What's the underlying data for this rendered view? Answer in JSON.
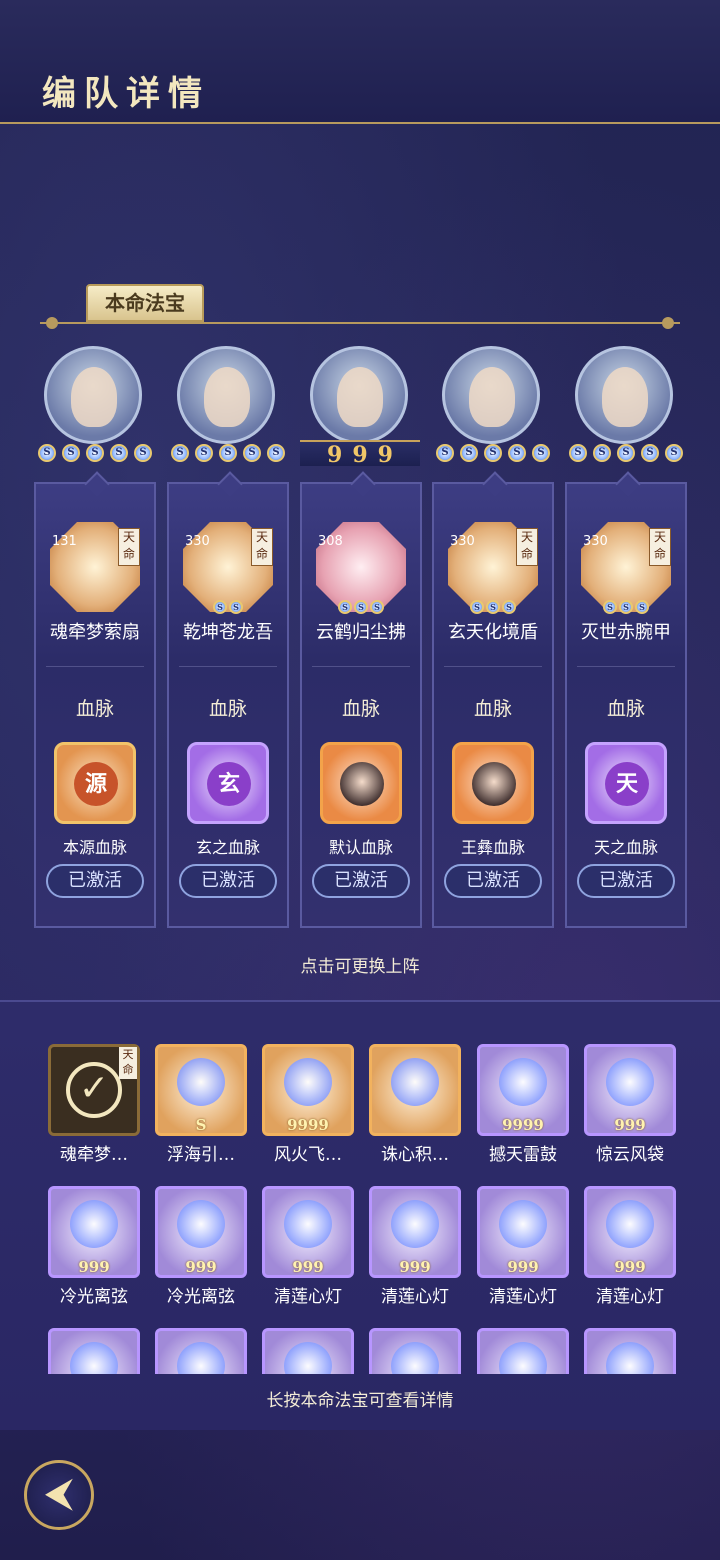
{
  "header": {
    "title": "编队详情"
  },
  "section_tab": "本命法宝",
  "columns": [
    {
      "stars_kind": "blue",
      "stars": [
        "S",
        "S",
        "S",
        "S",
        "S"
      ],
      "level": "131",
      "tianming": "天命",
      "artifact_stars": [],
      "artifact_name": "魂牵梦萦扇",
      "blood_title": "血脉",
      "blood_icon": "源",
      "blood_style": "gold",
      "blood_name": "本源血脉",
      "status": "已激活"
    },
    {
      "stars_kind": "blue",
      "stars": [
        "S",
        "S",
        "S",
        "S",
        "S"
      ],
      "level": "330",
      "tianming": "天命",
      "artifact_stars": [
        "S",
        "S"
      ],
      "artifact_name": "乾坤苍龙吾",
      "blood_title": "血脉",
      "blood_icon": "玄",
      "blood_style": "purple",
      "blood_name": "玄之血脉",
      "status": "已激活"
    },
    {
      "stars_kind": "gold",
      "stars": [
        "9",
        "9",
        "9"
      ],
      "level": "308",
      "tianming": "",
      "artifact_stars": [
        "S",
        "S",
        "S"
      ],
      "artifact_name": "云鹤归尘拂",
      "blood_title": "血脉",
      "blood_icon": "face",
      "blood_style": "orange",
      "blood_name": "默认血脉",
      "status": "已激活"
    },
    {
      "stars_kind": "blue",
      "stars": [
        "S",
        "S",
        "S",
        "S",
        "S"
      ],
      "level": "330",
      "tianming": "天命",
      "artifact_stars": [
        "S",
        "S",
        "S"
      ],
      "artifact_name": "玄天化境盾",
      "blood_title": "血脉",
      "blood_icon": "face",
      "blood_style": "orange",
      "blood_name": "王彝血脉",
      "status": "已激活"
    },
    {
      "stars_kind": "blue",
      "stars": [
        "S",
        "S",
        "S",
        "S",
        "S"
      ],
      "level": "330",
      "tianming": "天命",
      "artifact_stars": [
        "S",
        "S",
        "S"
      ],
      "artifact_name": "灭世赤腕甲",
      "blood_title": "血脉",
      "blood_icon": "天",
      "blood_style": "purple",
      "blood_name": "天之血脉",
      "status": "已激活"
    }
  ],
  "hint_swap": "点击可更换上阵",
  "items": [
    {
      "name": "魂牵梦…",
      "style": "dark",
      "stars": "",
      "checked": true,
      "tianming": "天命"
    },
    {
      "name": "浮海引…",
      "style": "gold",
      "stars": "S",
      "checked": false,
      "tianming": ""
    },
    {
      "name": "风火飞…",
      "style": "gold",
      "stars": "9999",
      "checked": false,
      "tianming": ""
    },
    {
      "name": "诛心积…",
      "style": "gold",
      "stars": "",
      "checked": false,
      "tianming": ""
    },
    {
      "name": "撼天雷鼓",
      "style": "purple",
      "stars": "9999",
      "checked": false,
      "tianming": ""
    },
    {
      "name": "惊云风袋",
      "style": "purple",
      "stars": "999",
      "checked": false,
      "tianming": ""
    },
    {
      "name": "冷光离弦",
      "style": "purple",
      "stars": "999",
      "checked": false,
      "tianming": ""
    },
    {
      "name": "冷光离弦",
      "style": "purple",
      "stars": "999",
      "checked": false,
      "tianming": ""
    },
    {
      "name": "清莲心灯",
      "style": "purple",
      "stars": "999",
      "checked": false,
      "tianming": ""
    },
    {
      "name": "清莲心灯",
      "style": "purple",
      "stars": "999",
      "checked": false,
      "tianming": ""
    },
    {
      "name": "清莲心灯",
      "style": "purple",
      "stars": "999",
      "checked": false,
      "tianming": ""
    },
    {
      "name": "清莲心灯",
      "style": "purple",
      "stars": "999",
      "checked": false,
      "tianming": ""
    },
    {
      "name": "",
      "style": "purple",
      "stars": "",
      "checked": false,
      "tianming": ""
    },
    {
      "name": "",
      "style": "purple",
      "stars": "",
      "checked": false,
      "tianming": ""
    },
    {
      "name": "",
      "style": "purple",
      "stars": "",
      "checked": false,
      "tianming": ""
    },
    {
      "name": "",
      "style": "purple",
      "stars": "",
      "checked": false,
      "tianming": ""
    },
    {
      "name": "",
      "style": "purple",
      "stars": "",
      "checked": false,
      "tianming": ""
    },
    {
      "name": "",
      "style": "purple",
      "stars": "",
      "checked": false,
      "tianming": ""
    }
  ],
  "hint_longpress": "长按本命法宝可查看详情",
  "back_icon": "back-arrow-icon"
}
